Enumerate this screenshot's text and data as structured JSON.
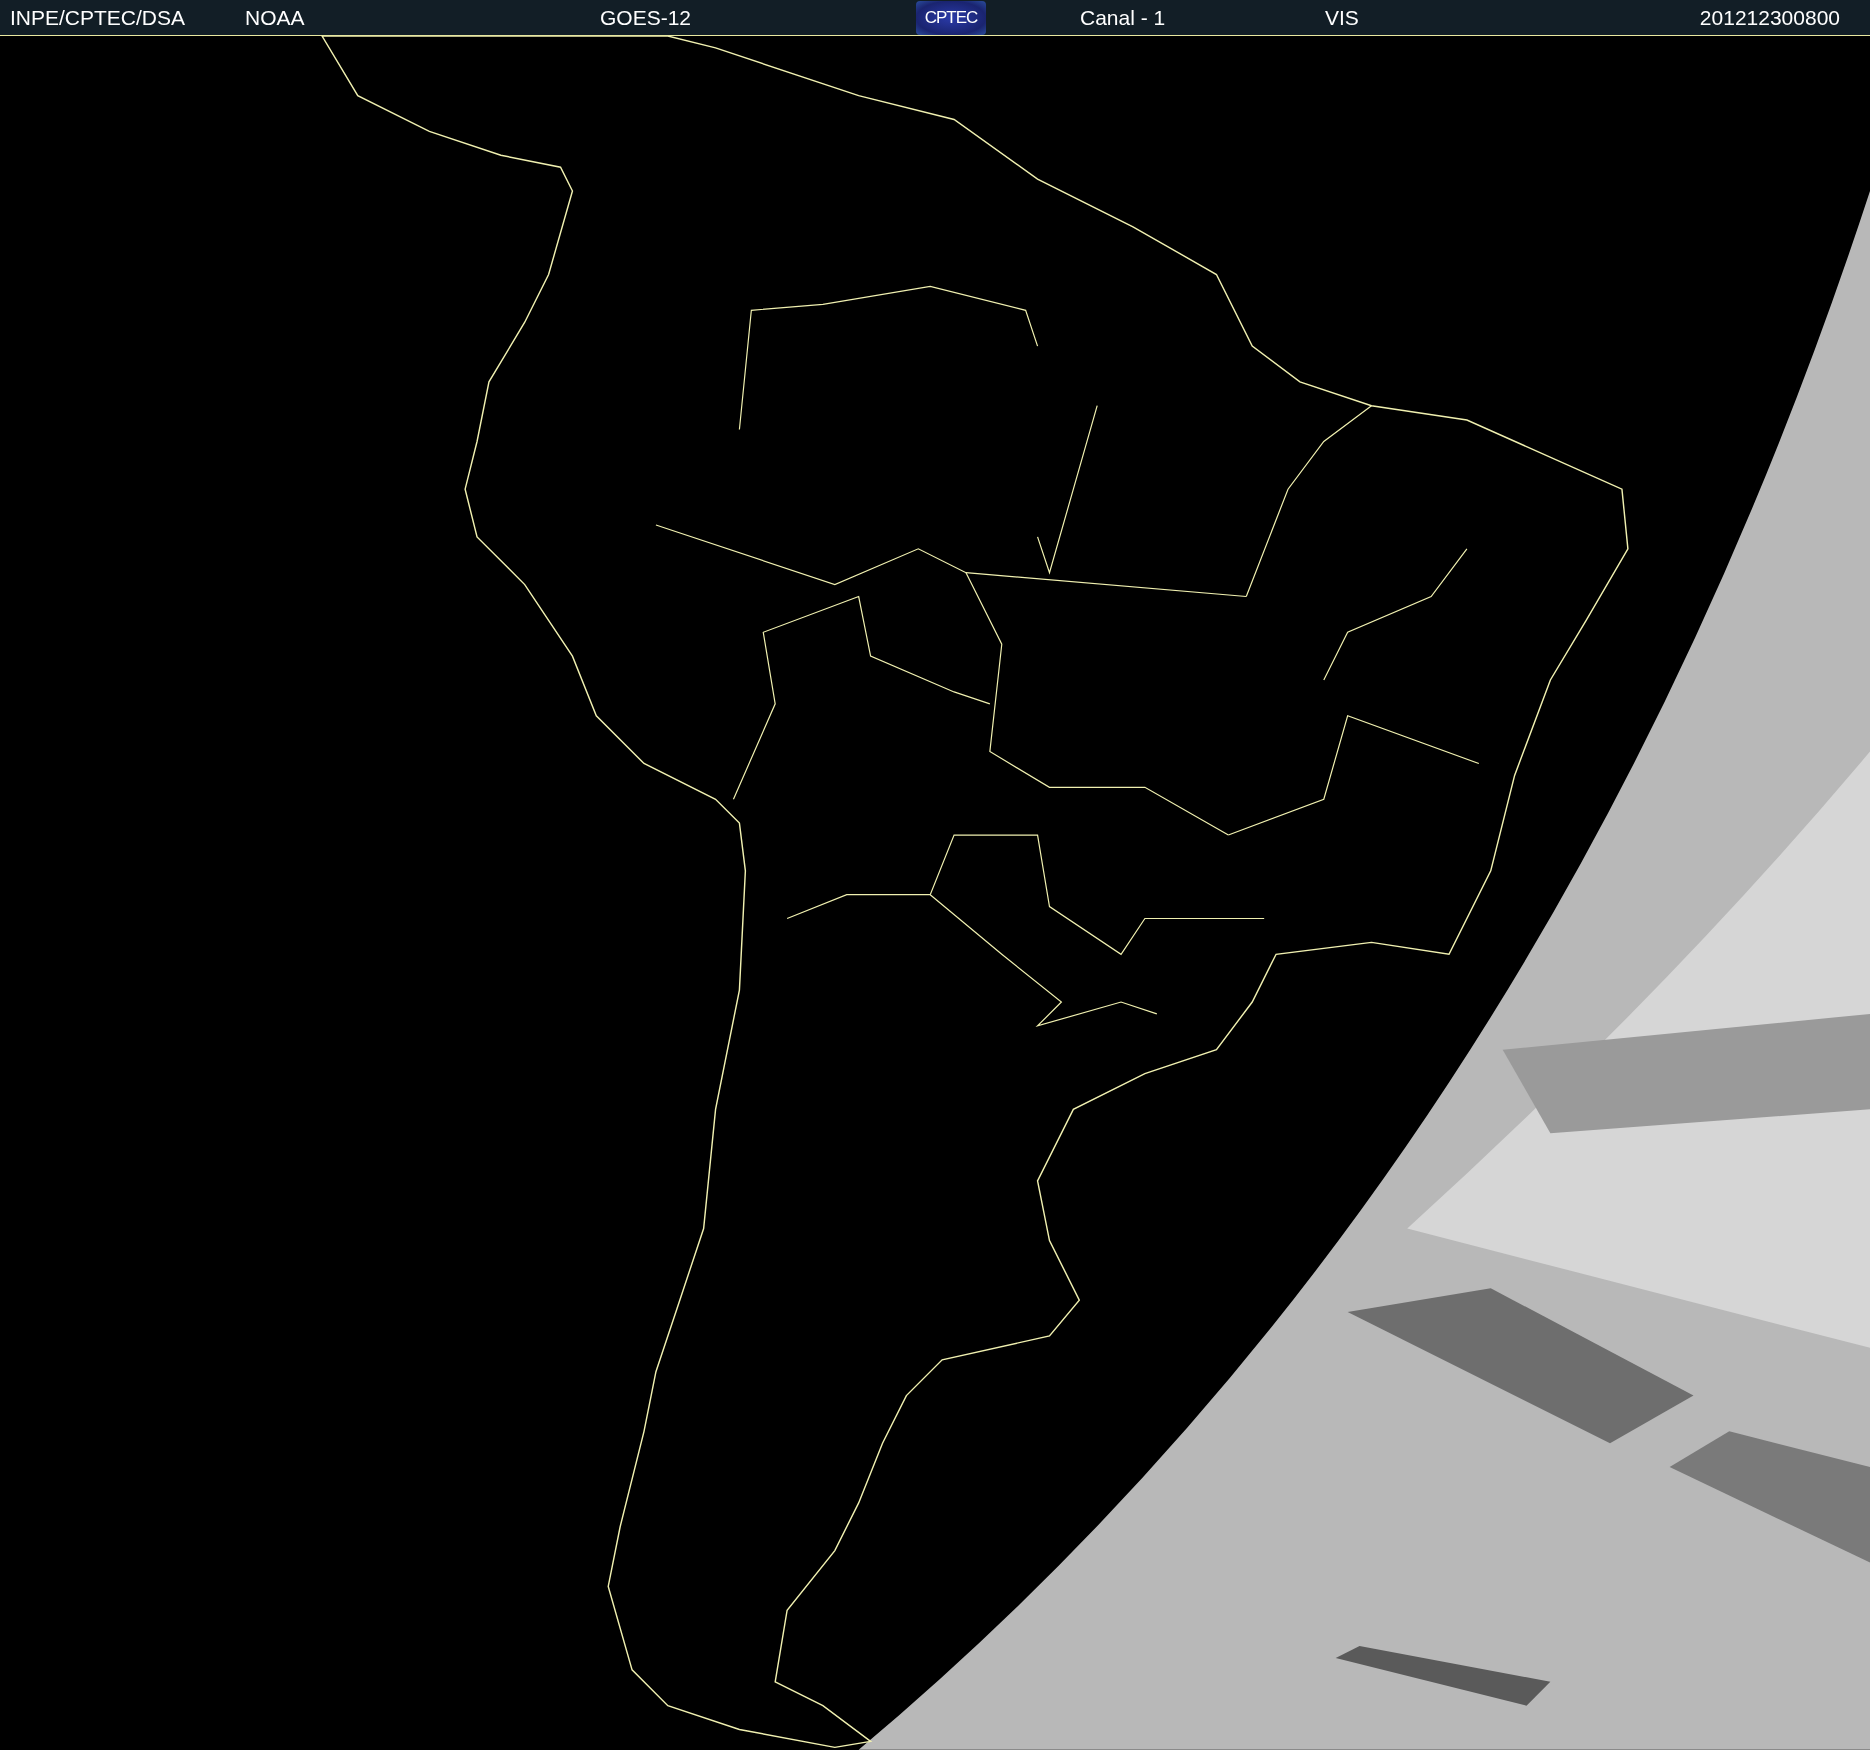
{
  "header": {
    "source": "INPE/CPTEC/DSA",
    "agency": "NOAA",
    "satellite": "GOES-12",
    "logo": "CPTEC",
    "channel": "Canal - 1",
    "band": "VIS",
    "timestamp": "201212300800"
  }
}
